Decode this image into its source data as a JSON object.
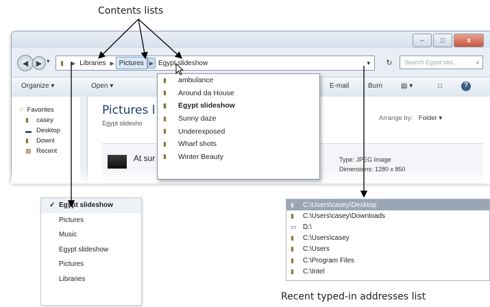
{
  "callouts": {
    "top": "Contents lists",
    "bottom": "Recent typed-in addresses list"
  },
  "window": {
    "buttons": {
      "minimize": "–",
      "maximize": "□",
      "close": "x"
    },
    "nav": {
      "back": "◀",
      "forward": "▶",
      "recent_arrow": "▾"
    },
    "breadcrumb": [
      "Libraries",
      "Pictures",
      "Egypt slideshow"
    ],
    "refresh": "↻",
    "search_placeholder": "Search Egypt slid...",
    "toolbar": {
      "organize": "Organize ▾",
      "open": "Open ▾",
      "email": "E-mail",
      "burn": "Burn",
      "views": "▤ ▾",
      "help": "?"
    },
    "nav_pane": [
      "Favorites",
      "casey",
      "Desktop",
      "Downl",
      "Recent"
    ],
    "library_title": "Pictures l",
    "library_subtitle": "Egypt slidesho",
    "arrange_label": "Arrange by:",
    "arrange_value": "Folder ▾",
    "file": {
      "name": "At sur",
      "type": "Type: JPEG Image",
      "dimensions": "Dimensions: 1280 x 850"
    }
  },
  "contents_dropdown": {
    "items": [
      "ambulance",
      "Around da House",
      "Egypt slideshow",
      "Sunny daze",
      "Underexposed",
      "Wharf shots",
      "Winter Beauty"
    ],
    "bold_item": "Egypt slideshow"
  },
  "history_menu": {
    "items": [
      "Egypt slideshow",
      "Pictures",
      "Music",
      "Egypt slideshow",
      "Pictures",
      "Libraries"
    ],
    "checked_index": 0
  },
  "recent_addresses": {
    "items": [
      "C:\\Users\\casey\\Desktop",
      "C:\\Users\\casey\\Downloads",
      "D:\\",
      "C:\\Users\\casey",
      "C:\\Users",
      "C:\\Program Files",
      "C:\\Intel"
    ],
    "selected_index": 0
  },
  "colors": {
    "accent": "#1e3c6e",
    "selection": "#9aa6b6"
  }
}
